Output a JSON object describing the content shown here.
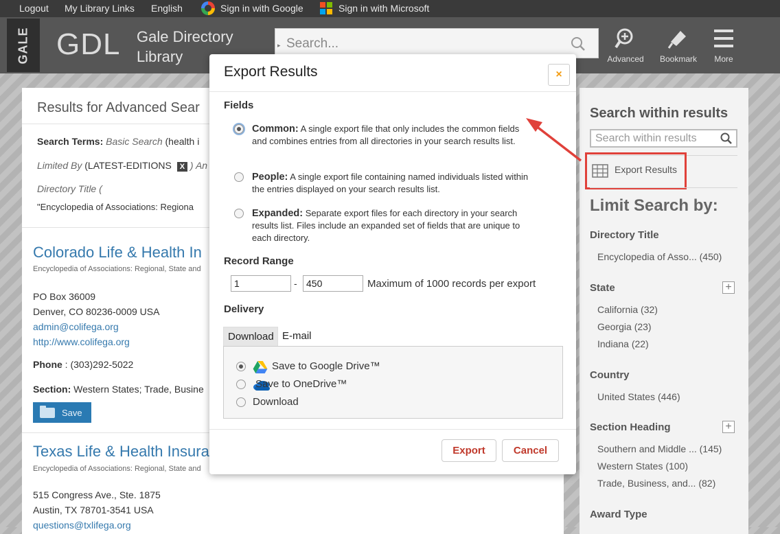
{
  "topbar": {
    "logout": "Logout",
    "my_library_links": "My Library Links",
    "language": "English",
    "google_signin": "Sign in with Google",
    "microsoft_signin": "Sign in with Microsoft"
  },
  "header": {
    "brand_vertical": "GALE",
    "brand_short": "GDL",
    "brand_title_line1": "Gale Directory",
    "brand_title_line2": "Library",
    "search_placeholder": "Search...",
    "advanced_label": "Advanced",
    "bookmark_label": "Bookmark",
    "more_label": "More"
  },
  "results": {
    "title": "Results for Advanced Sear",
    "search_terms_label": "Search Terms:",
    "search_terms_type": "Basic Search",
    "search_terms_value": "(health i",
    "limited_by_label": "Limited By",
    "limited_by_value": "(LATEST-EDITIONS",
    "limited_by_remove": "X",
    "limited_by_tail": ") An",
    "directory_title_label": "Directory Title (",
    "directory_title_value": "\"Encyclopedia of Associations: Regiona",
    "entries": [
      {
        "title": "Colorado Life & Health In",
        "source": "Encyclopedia of Associations: Regional, State and",
        "address1": "PO Box 36009",
        "address2": "Denver, CO 80236-0009 USA",
        "email": "admin@colifega.org",
        "website": "http://www.colifega.org",
        "phone_label": "Phone",
        "phone": ": (303)292-5022",
        "section_label": "Section:",
        "section": "Western States; Trade, Busine",
        "save_label": "Save"
      },
      {
        "title": "Texas Life & Health Insura",
        "source": "Encyclopedia of Associations: Regional, State and",
        "address1": "515 Congress Ave., Ste. 1875",
        "address2": "Austin, TX 78701-3541 USA",
        "email": "questions@txlifega.org"
      }
    ]
  },
  "sidebar": {
    "search_within_title": "Search within results",
    "search_within_placeholder": "Search within results",
    "export_results_label": "Export Results",
    "limit_title": "Limit Search by:",
    "sections": [
      {
        "heading": "Directory Title",
        "items": [
          "Encyclopedia of Asso... (450)"
        ]
      },
      {
        "heading": "State",
        "items": [
          "California (32)",
          "Georgia (23)",
          "Indiana (22)"
        ],
        "expand": "+"
      },
      {
        "heading": "Country",
        "items": [
          "United States (446)"
        ]
      },
      {
        "heading": "Section Heading",
        "items": [
          "Southern and Middle ... (145)",
          "Western States (100)",
          "Trade, Business, and... (82)"
        ],
        "expand": "+"
      },
      {
        "heading": "Award Type",
        "items": []
      }
    ]
  },
  "modal": {
    "title": "Export Results",
    "close_label": "×",
    "fields_heading": "Fields",
    "options": [
      {
        "name": "Common:",
        "desc": "A single export file that only includes the common fields and combines entries from all directories in your search results list.",
        "selected": true
      },
      {
        "name": "People:",
        "desc": "A single export file containing named individuals listed within the entries displayed on your search results list.",
        "selected": false
      },
      {
        "name": "Expanded:",
        "desc": "Separate export files for each directory in your search results list. Files include an expanded set of fields that are unique to each directory.",
        "selected": false
      }
    ],
    "record_range_heading": "Record Range",
    "range_from": "1",
    "range_sep": "-",
    "range_to": "450",
    "range_note": "Maximum of 1000 records per export",
    "delivery_heading": "Delivery",
    "tabs": [
      "Download",
      "E-mail"
    ],
    "delivery_options": [
      {
        "label": "Save to Google Drive™",
        "icon": "google-drive-icon",
        "selected": true
      },
      {
        "label": "Save to OneDrive™",
        "icon": "onedrive-icon",
        "selected": false
      },
      {
        "label": "Download",
        "icon": "",
        "selected": false
      }
    ],
    "export_button": "Export",
    "cancel_button": "Cancel"
  },
  "colors": {
    "topbar_bg": "#3a3a3a",
    "header_bg": "#565656",
    "link": "#3579ad",
    "accent_red": "#e0413a",
    "button_text": "#c0392b",
    "save_button_bg": "#2a7ab3"
  }
}
